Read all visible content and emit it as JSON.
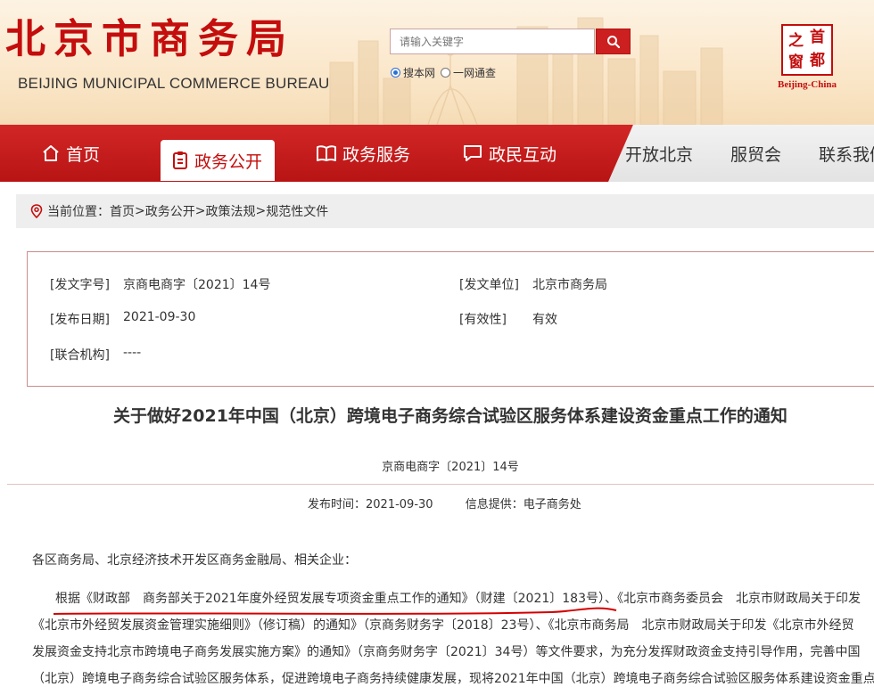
{
  "header": {
    "logo_cn": "北京市商务局",
    "logo_en": "BEIJING MUNICIPAL COMMERCE BUREAU",
    "search_placeholder": "请输入关键字",
    "search_options": [
      "搜本网",
      "一网通查"
    ],
    "search_selected": "搜本网",
    "brand_seal_chars": [
      "之",
      "首",
      "窗",
      "都"
    ],
    "brand_name": "Beijing-China"
  },
  "nav": {
    "items": [
      "首页",
      "政务公开",
      "政务服务",
      "政民互动",
      "开放北京",
      "服贸会",
      "联系我们"
    ],
    "active": "政务公开"
  },
  "breadcrumb": {
    "label": "当前位置：",
    "items": [
      "首页",
      "政务公开",
      "政策法规",
      "规范性文件"
    ],
    "separator": ">"
  },
  "info": {
    "doc_no_label": "[发文字号]",
    "doc_no": "京商电商字〔2021〕14号",
    "issuer_label": "[发文单位]",
    "issuer": "北京市商务局",
    "date_label": "[发布日期]",
    "date": "2021-09-30",
    "validity_label": "[有效性]",
    "validity": "有效",
    "joint_label": "[联合机构]",
    "joint": "----"
  },
  "article": {
    "title": "关于做好2021年中国（北京）跨境电子商务综合试验区服务体系建设资金重点工作的通知",
    "doc_no": "京商电商字〔2021〕14号",
    "publish_time_label": "发布时间：",
    "publish_time": "2021-09-30",
    "source_label": "信息提供：",
    "source": "电子商务处",
    "salutation": "各区商务局、北京经济技术开发区商务金融局、相关企业：",
    "lines": [
      "根据《财政部　商务部关于2021年度外经贸发展专项资金重点工作的通知》（财建〔2021〕183号）、《北京市商务委员会　北京市财政局关于印发",
      "《北京市外经贸发展资金管理实施细则》（修订稿）的通知》（京商务财务字〔2018〕23号）、《北京市商务局　北京市财政局关于印发《北京市外经贸",
      "发展资金支持北京市跨境电子商务发展实施方案》的通知》（京商务财务字〔2021〕34号）等文件要求，为充分发挥财政资金支持引导作用，完善中国",
      "（北京）跨境电子商务综合试验区服务体系，促进跨境电子商务持续健康发展，现将2021年中国（北京）跨境电子商务综合试验区服务体系建设资金重点"
    ]
  },
  "colors": {
    "brand_red": "#c40d0d",
    "nav_red": "#c81a1a",
    "nav_grey": "#ebebeb",
    "breadcrumb_bg": "#eeeeee",
    "highlight_underline": "#d40000"
  }
}
